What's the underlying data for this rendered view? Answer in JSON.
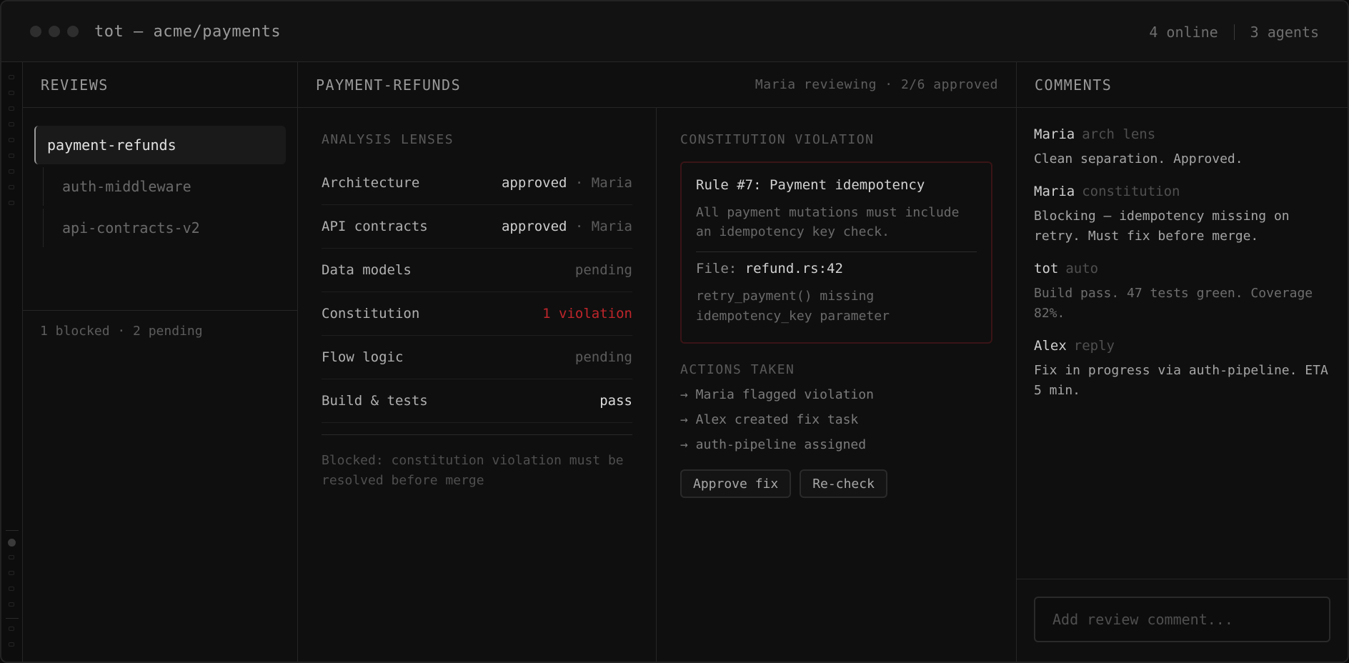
{
  "window": {
    "title": "tot — acme/payments",
    "online": "4 online",
    "agents": "3 agents"
  },
  "reviews": {
    "heading": "REVIEWS",
    "items": [
      "payment-refunds",
      "auth-middleware",
      "api-contracts-v2"
    ],
    "summary": "1 blocked · 2 pending"
  },
  "center": {
    "heading": "PAYMENT-REFUNDS",
    "status": "Maria reviewing · 2/6 approved",
    "lenses_title": "ANALYSIS LENSES",
    "lenses": [
      {
        "name": "Architecture",
        "value": "approved",
        "by": " · Maria"
      },
      {
        "name": "API contracts",
        "value": "approved",
        "by": " · Maria"
      },
      {
        "name": "Data models",
        "value": "pending",
        "by": ""
      },
      {
        "name": "Constitution",
        "value": "1 violation",
        "by": ""
      },
      {
        "name": "Flow logic",
        "value": "pending",
        "by": ""
      },
      {
        "name": "Build & tests",
        "value": "pass",
        "by": ""
      }
    ],
    "blocked_note": "Blocked: constitution violation must be resolved before merge"
  },
  "violation": {
    "title": "CONSTITUTION VIOLATION",
    "rule": "Rule #7: Payment idempotency",
    "description": "All payment mutations must include an idempotency key check.",
    "file_label": "File: ",
    "file": "refund.rs:42",
    "detail": "retry_payment() missing idempotency_key parameter",
    "actions_title": "ACTIONS TAKEN",
    "actions": [
      "→ Maria flagged violation",
      "→ Alex created fix task",
      "→ auth-pipeline assigned"
    ],
    "approve_label": "Approve fix",
    "recheck_label": "Re-check"
  },
  "comments": {
    "heading": "COMMENTS",
    "items": [
      {
        "author": "Maria",
        "tag": "arch lens",
        "body": "Clean separation. Approved."
      },
      {
        "author": "Maria",
        "tag": "constitution",
        "body": "Blocking — idempotency missing on retry. Must fix before merge."
      },
      {
        "author": "tot",
        "tag": "auto",
        "body": "Build pass. 47 tests green. Coverage 82%."
      },
      {
        "author": "Alex",
        "tag": "reply",
        "body": "Fix in progress via auth-pipeline. ETA 5 min."
      }
    ],
    "input_placeholder": "Add review comment..."
  },
  "colors": {
    "violation": "#c0262b",
    "violation_border": "#3a1416",
    "background": "#0f0f0f"
  }
}
